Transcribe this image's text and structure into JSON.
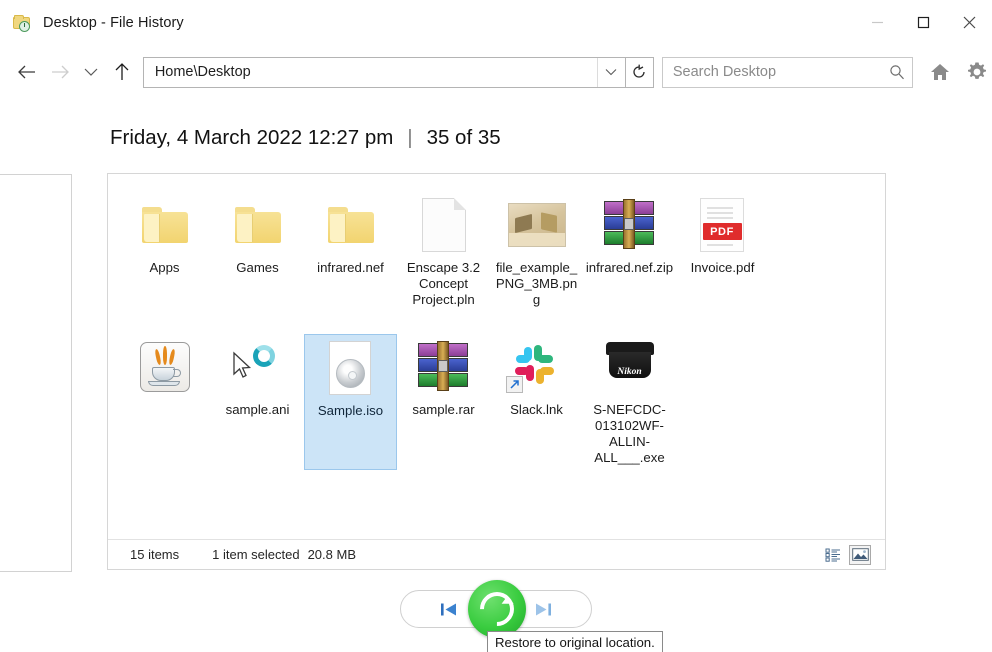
{
  "window": {
    "title": "Desktop - File History",
    "title_icon": "folder-clock-icon",
    "minimize_label": "—",
    "maximize_label": "□",
    "close_label": "✕"
  },
  "nav": {
    "back_icon": "back-arrow-icon",
    "forward_icon": "forward-arrow-icon",
    "recent_icon": "chevron-down-icon",
    "up_icon": "up-arrow-icon",
    "address_value": "Home\\Desktop",
    "address_chevron_icon": "chevron-down-icon",
    "refresh_icon": "refresh-icon",
    "search_placeholder": "Search Desktop",
    "search_value": "",
    "search_icon": "search-icon",
    "home_icon": "home-icon",
    "settings_icon": "gear-icon"
  },
  "header": {
    "date": "Friday, 4 March 2022 12:27 pm",
    "separator": "|",
    "counter": "35 of 35"
  },
  "files": [
    {
      "name": "Apps",
      "icon": "folder-icon",
      "selected": false
    },
    {
      "name": "Games",
      "icon": "folder-icon",
      "selected": false
    },
    {
      "name": "infrared.nef",
      "icon": "folder-icon",
      "selected": false
    },
    {
      "name": "Enscape 3.2 Concept Project.pln",
      "icon": "document-icon",
      "selected": false
    },
    {
      "name": "file_example_PNG_3MB.png",
      "icon": "photo-icon",
      "selected": false
    },
    {
      "name": "infrared.nef.zip",
      "icon": "winrar-icon",
      "selected": false
    },
    {
      "name": "Invoice.pdf",
      "icon": "pdf-icon",
      "selected": false
    },
    {
      "name": "",
      "icon": "java-icon",
      "selected": false
    },
    {
      "name": "sample.ani",
      "icon": "cursor-ani-icon",
      "selected": false
    },
    {
      "name": "Sample.iso",
      "icon": "disc-image-icon",
      "selected": true
    },
    {
      "name": "sample.rar",
      "icon": "winrar-icon",
      "selected": false
    },
    {
      "name": "Slack.lnk",
      "icon": "slack-shortcut-icon",
      "selected": false
    },
    {
      "name": "S-NEFCDC-013102WF-ALLIN-ALL___.exe",
      "icon": "nikon-exe-icon",
      "selected": false
    }
  ],
  "pdf_badge_text": "PDF",
  "nikon_brand_text": "Nikon",
  "status": {
    "items": "15 items",
    "selection": "1 item selected",
    "size": "20.8 MB",
    "details_view_icon": "details-view-icon",
    "large_icons_view_icon": "large-icons-view-icon"
  },
  "controls": {
    "previous_label": "⏮",
    "restore_label": "restore-icon",
    "next_label": "⏭",
    "tooltip": "Restore to original location."
  },
  "colors": {
    "accent_green": "#39cc3f",
    "selection_blue": "#cce4f7",
    "pdf_red": "#e02c2c"
  }
}
